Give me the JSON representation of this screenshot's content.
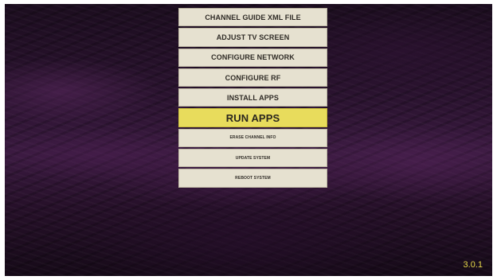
{
  "menu": {
    "items": [
      {
        "label": "CHANNEL GUIDE XML FILE"
      },
      {
        "label": "ADJUST TV SCREEN"
      },
      {
        "label": "CONFIGURE NETWORK"
      },
      {
        "label": "CONFIGURE RF"
      },
      {
        "label": "INSTALL APPS"
      },
      {
        "label": "RUN APPS",
        "selected": true
      },
      {
        "label": "ERASE CHANNEL INFO"
      },
      {
        "label": "UPDATE SYSTEM"
      },
      {
        "label": "REBOOT SYSTEM"
      }
    ]
  },
  "version": "3.0.1",
  "colors": {
    "item_background": "#e6e1d0",
    "selected_background": "#e8dc5c",
    "version_text": "#e8d94a"
  }
}
